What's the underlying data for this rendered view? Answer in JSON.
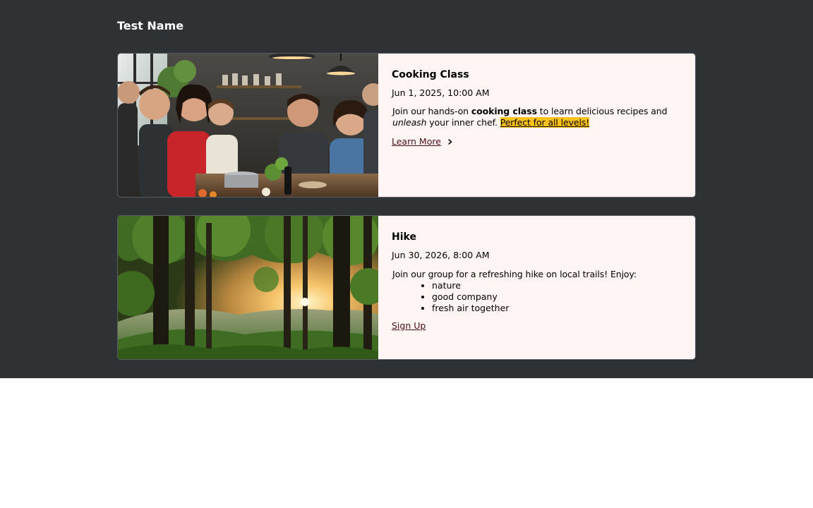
{
  "header": {
    "title": "Test Name"
  },
  "events": [
    {
      "title": "Cooking Class",
      "date": "Jun 1, 2025, 10:00 AM",
      "desc_pre": "Join our hands-on ",
      "desc_bold": "cooking class",
      "desc_mid": " to learn delicious recipes and ",
      "desc_italic": "unleash",
      "desc_post": " your inner chef. ",
      "desc_highlight": "Perfect for all levels!",
      "link_label": "Learn More",
      "link_icon": "chevron-right-icon",
      "image": "cooking-class-photo"
    },
    {
      "title": "Hike",
      "date": "Jun 30, 2026, 8:00 AM",
      "desc_intro": "Join our group for a refreshing hike on local trails! Enjoy:",
      "list": [
        "nature",
        "good company",
        "fresh air together"
      ],
      "link_label": "Sign Up",
      "image": "forest-sunset-photo"
    }
  ],
  "colors": {
    "background": "#2f3235",
    "card": "#fff5f5",
    "highlight": "#ffc21a",
    "link": "#4a0c14"
  }
}
